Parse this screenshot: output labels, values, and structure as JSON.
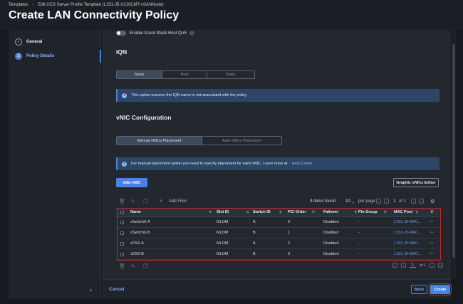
{
  "header": {
    "breadcrumb": [
      "Templates",
      "Edit UCS Server Profile Template (L151-J5-X210CM7-vSANNode)"
    ],
    "title": "Create LAN Connectivity Policy"
  },
  "sidebar": {
    "steps": [
      {
        "number": "✓",
        "label": "General"
      },
      {
        "number": "2",
        "label": "Policy Details"
      }
    ]
  },
  "azure_toggle": {
    "label": "Enable Azure Stack Host QoS",
    "enabled": false
  },
  "iqn": {
    "title": "IQN",
    "options": [
      "None",
      "Pool",
      "Static"
    ],
    "selected": "None",
    "alert": "This option ensures the IQN name is not associated with the policy"
  },
  "vnic": {
    "title": "vNIC Configuration",
    "options": [
      "Manual vNICs Placement",
      "Auto vNICs Placement"
    ],
    "selected": "Manual vNICs Placement",
    "alert": "For manual placement option you need to specify placement for each vNIC. Learn more at",
    "alert_link": "Help Center",
    "add_button": "Add vNIC",
    "graphic_button": "Graphic vNICs Editor"
  },
  "table": {
    "add_filter": "Add Filter",
    "items_found": "4 items found",
    "per_page_value": "10",
    "per_page_label": "per page",
    "page": "1",
    "of_pages": "of 1",
    "columns": [
      "Name",
      "Slot ID",
      "Switch ID",
      "PCI Order",
      "Failover",
      "Pin Group",
      "MAC Pool"
    ],
    "rows": [
      {
        "name": "vSwitch0-A",
        "slot": "MLOM",
        "switch": "A",
        "pci": "0",
        "failover": "Disabled",
        "pin": "-",
        "mac": "L151-J5-MAC..."
      },
      {
        "name": "vSwitch0-B",
        "slot": "MLOM",
        "switch": "B",
        "pci": "1",
        "failover": "Disabled",
        "pin": "-",
        "mac": "L151-J5-MAC..."
      },
      {
        "name": "vDS0-A",
        "slot": "MLOM",
        "switch": "A",
        "pci": "2",
        "failover": "Disabled",
        "pin": "-",
        "mac": "L151-J5-MAC..."
      },
      {
        "name": "vDS0-B",
        "slot": "MLOM",
        "switch": "B",
        "pci": "3",
        "failover": "Disabled",
        "pin": "-",
        "mac": "L151-J5-MAC..."
      }
    ],
    "bottom_page": "1",
    "bottom_of": "of 1"
  },
  "footer": {
    "cancel": "Cancel",
    "back": "Back",
    "create": "Create"
  },
  "colors": {
    "accent": "#4a82e6",
    "highlight": "#c1282e",
    "link": "#6b9cf2"
  }
}
